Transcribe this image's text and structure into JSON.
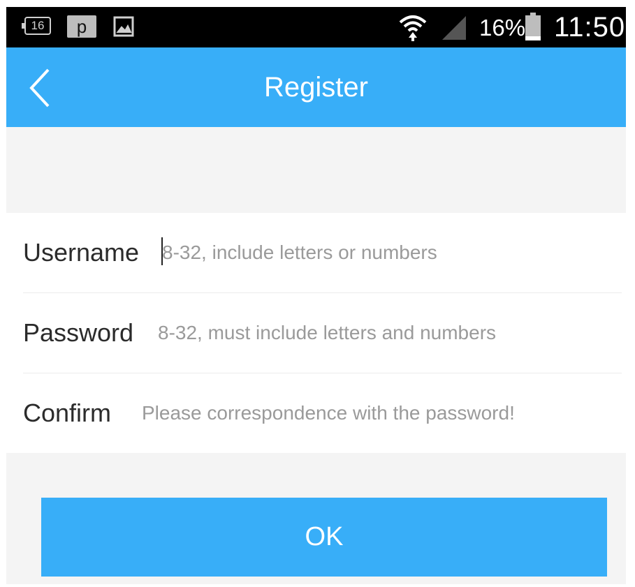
{
  "status_bar": {
    "notification_badge": "16",
    "notification_p": "p",
    "icons": [
      "notification-16-icon",
      "p-app-icon",
      "gallery-icon",
      "wifi-icon",
      "cell-signal-icon",
      "battery-icon"
    ],
    "battery_percent": "16%",
    "battery_level": 0.16,
    "time": "11:50"
  },
  "app_bar": {
    "title": "Register",
    "back_icon": "chevron-left-icon"
  },
  "form": {
    "username": {
      "label": "Username",
      "placeholder": "8-32, include letters or numbers",
      "value": ""
    },
    "password": {
      "label": "Password",
      "placeholder": "8-32, must include letters and numbers",
      "value": ""
    },
    "confirm": {
      "label": "Confirm",
      "placeholder": "Please correspondence with the password!",
      "value": ""
    }
  },
  "ok_button": {
    "label": "OK"
  },
  "colors": {
    "accent": "#38aef8",
    "background": "#f4f4f4",
    "status_bar": "#000000",
    "placeholder": "#9a9a9a"
  }
}
